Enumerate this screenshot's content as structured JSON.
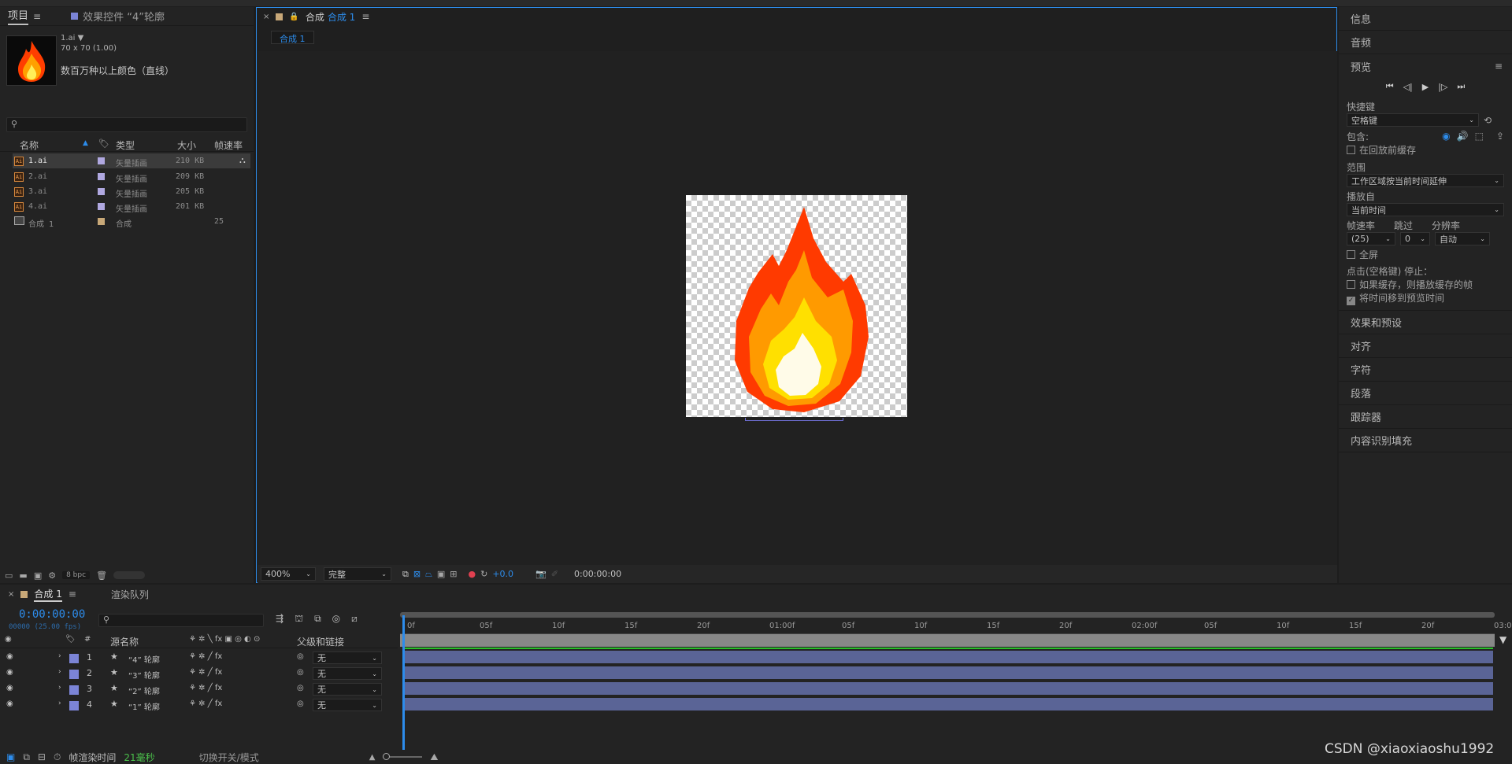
{
  "project": {
    "tab_label": "项目",
    "effects_tab": "效果控件 “4”轮廓",
    "file_name": "1.ai ▼",
    "file_dims": "70 x 70 (1.00)",
    "file_colors": "数百万种以上颜色（直线）",
    "columns": [
      "名称",
      "类型",
      "大小",
      "帧速率"
    ],
    "items": [
      {
        "name": "1.ai",
        "type": "矢量插画",
        "size": "210 KB",
        "fps": ""
      },
      {
        "name": "2.ai",
        "type": "矢量插画",
        "size": "209 KB",
        "fps": ""
      },
      {
        "name": "3.ai",
        "type": "矢量插画",
        "size": "205 KB",
        "fps": ""
      },
      {
        "name": "4.ai",
        "type": "矢量插画",
        "size": "201 KB",
        "fps": ""
      },
      {
        "name": "合成 1",
        "type": "合成",
        "size": "",
        "fps": "25"
      }
    ],
    "bpc": "8 bpc"
  },
  "comp": {
    "tab_prefix": "合成",
    "tab_name": "合成 1",
    "breadcrumb": "合成 1",
    "zoom": "400%",
    "quality": "完整",
    "exposure": "+0.0",
    "timecode": "0:00:00:00"
  },
  "right": {
    "info": "信息",
    "audio": "音频",
    "preview": "预览",
    "shortcut_label": "快捷键",
    "shortcut": "空格键",
    "include_label": "包含:",
    "cache_before": "在回放前缓存",
    "range_label": "范围",
    "range": "工作区域按当前时间延伸",
    "play_from_label": "播放自",
    "play_from": "当前时间",
    "fps_label": "帧速率",
    "skip_label": "跳过",
    "res_label": "分辨率",
    "fps": "(25)",
    "skip": "0",
    "res": "自动",
    "fullscreen": "全屏",
    "stop_label": "点击(空格键) 停止：",
    "if_cached": "如果缓存，则播放缓存的帧",
    "move_time": "将时间移到预览时间",
    "sections": [
      "效果和预设",
      "对齐",
      "字符",
      "段落",
      "跟踪器",
      "内容识别填充"
    ]
  },
  "timeline": {
    "tab": "合成 1",
    "render_queue": "渲染队列",
    "time": "0:00:00:00",
    "frames": "00000 (25.00 fps)",
    "col_source": "源名称",
    "col_parent": "父级和链接",
    "layers": [
      {
        "num": "1",
        "name": "“4” 轮廓",
        "parent": "无"
      },
      {
        "num": "2",
        "name": "“3” 轮廓",
        "parent": "无"
      },
      {
        "num": "3",
        "name": "“2” 轮廓",
        "parent": "无"
      },
      {
        "num": "4",
        "name": "“1” 轮廓",
        "parent": "无"
      }
    ],
    "ticks": [
      "0f",
      "05f",
      "10f",
      "15f",
      "20f",
      "01:00f",
      "05f",
      "10f",
      "15f",
      "20f",
      "02:00f",
      "05f",
      "10f",
      "15f",
      "20f",
      "03:0"
    ],
    "render_time_label": "帧渲染时间",
    "render_time": "21毫秒",
    "toggle": "切换开关/模式"
  },
  "watermark": "CSDN @xiaoxiaoshu1992",
  "colors": {
    "accent": "#2d8ceb",
    "layer": "#7b84d6",
    "bar": "#5a6496",
    "flame": "#ff8a00"
  }
}
